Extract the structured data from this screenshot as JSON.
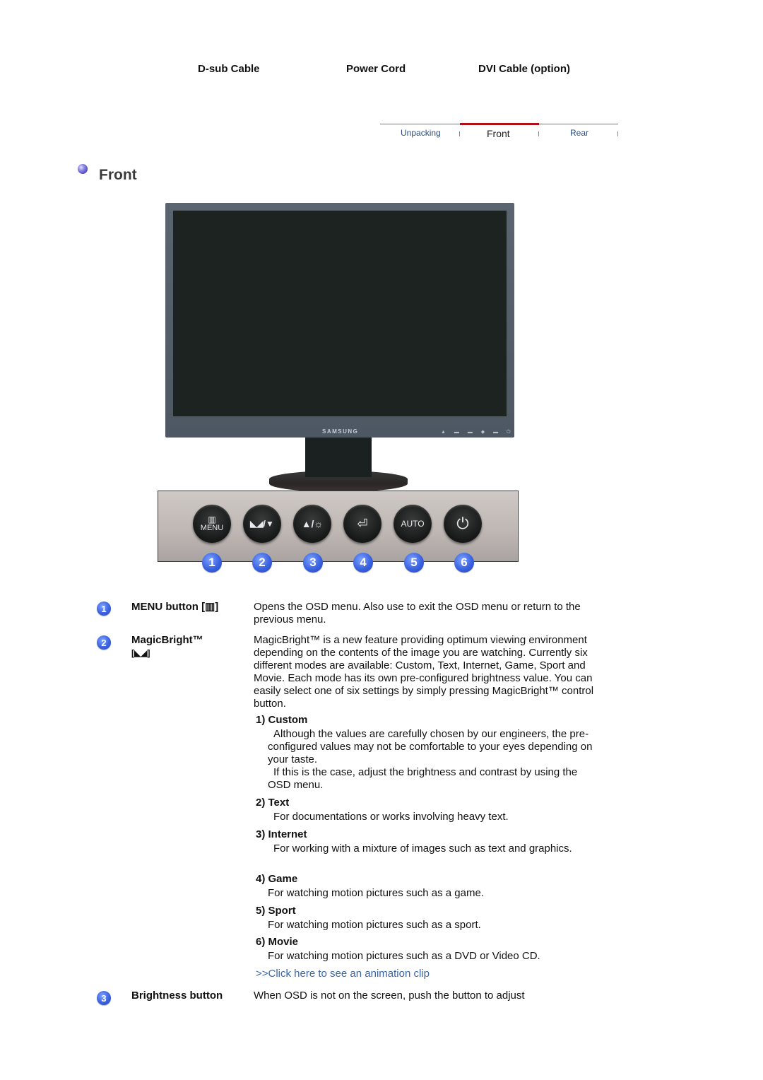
{
  "cables": {
    "dsub": "D-sub Cable",
    "power": "Power Cord",
    "dvi": "DVI Cable (option)"
  },
  "nav": {
    "tabs": [
      {
        "label": "Unpacking",
        "active": false
      },
      {
        "label": "Front",
        "active": true
      },
      {
        "label": "Rear",
        "active": false
      }
    ],
    "active_color": "#b0101a"
  },
  "section": {
    "title": "Front",
    "bullet_icon": "purple-sphere-bullet-icon"
  },
  "monitor": {
    "brand": "SAMSUNG",
    "bezel_buttons": "▲ ▬ ▬ ◆ ▬ ⏻"
  },
  "panel": {
    "buttons": [
      {
        "number": "1",
        "icon": "menu-icon",
        "glyph": "▥",
        "label": "MENU"
      },
      {
        "number": "2",
        "icon": "magicbright-down-icon",
        "glyph": "◣◢/▼",
        "label": ""
      },
      {
        "number": "3",
        "icon": "up-brightness-icon",
        "glyph": "▲/☼",
        "label": ""
      },
      {
        "number": "4",
        "icon": "enter-icon",
        "glyph": "⏎",
        "label": ""
      },
      {
        "number": "5",
        "icon": "auto-icon",
        "glyph": "AUTO",
        "label": ""
      },
      {
        "number": "6",
        "icon": "power-icon",
        "glyph": "⏻",
        "label": ""
      }
    ]
  },
  "items": [
    {
      "number": "1",
      "term": "MENU button [▥]",
      "description": "Opens the OSD menu. Also use to exit the OSD menu or return to the previous menu."
    },
    {
      "number": "2",
      "term": "MagicBright™",
      "term_icon": "[◣◢]",
      "description": "MagicBright™ is a new feature providing optimum viewing environment depending on the contents of the image you are watching. Currently six different modes are available: Custom, Text, Internet, Game, Sport and Movie. Each mode has its own pre-configured brightness value. You can easily select one of six settings by simply pressing MagicBright™ control button.",
      "modes": [
        {
          "title": "1) Custom",
          "text1": "Although the values are carefully chosen by our engineers, the pre-configured values may not be comfortable to your eyes depending on your taste.",
          "text2": "If this is the case, adjust the brightness and contrast by using the OSD menu."
        },
        {
          "title": "2) Text",
          "text1": "For documentations or works involving heavy text."
        },
        {
          "title": "3) Internet",
          "text1": "For working with a mixture of images such as text and graphics."
        },
        {
          "title": "4) Game",
          "text1": "For watching motion pictures such as a game."
        },
        {
          "title": "5) Sport",
          "text1": "For watching motion pictures such as a sport."
        },
        {
          "title": "6) Movie",
          "text1": "For watching motion pictures such as a DVD or Video CD."
        }
      ],
      "link": ">>Click here to see an animation clip"
    },
    {
      "number": "3",
      "term": "Brightness button",
      "description": "When OSD is not on the screen, push the button to adjust"
    }
  ],
  "colors": {
    "link": "#3a66a8",
    "badge": "#3a62e0"
  }
}
